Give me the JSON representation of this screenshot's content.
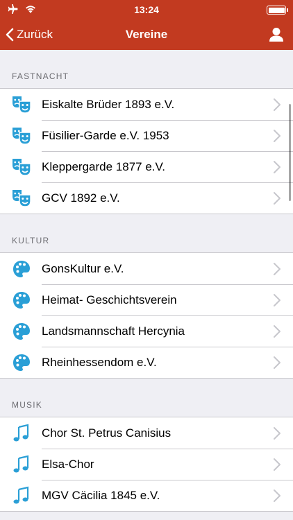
{
  "status_bar": {
    "time": "13:24"
  },
  "nav": {
    "back_label": "Zurück",
    "title": "Vereine"
  },
  "colors": {
    "brand": "#c23a20",
    "icon_accent": "#2a9fd6"
  },
  "sections": [
    {
      "title": "FASTNACHT",
      "icon": "theater-masks-icon",
      "items": [
        "Eiskalte Brüder 1893 e.V.",
        "Füsilier-Garde e.V. 1953",
        "Kleppergarde 1877 e.V.",
        "GCV 1892 e.V."
      ]
    },
    {
      "title": "KULTUR",
      "icon": "palette-icon",
      "items": [
        "GonsKultur e.V.",
        "Heimat- Geschichtsverein",
        "Landsmannschaft Hercynia",
        "Rheinhessendom e.V."
      ]
    },
    {
      "title": "MUSIK",
      "icon": "music-note-icon",
      "items": [
        "Chor St. Petrus Canisius",
        "Elsa-Chor",
        "MGV Cäcilia 1845 e.V."
      ]
    }
  ]
}
